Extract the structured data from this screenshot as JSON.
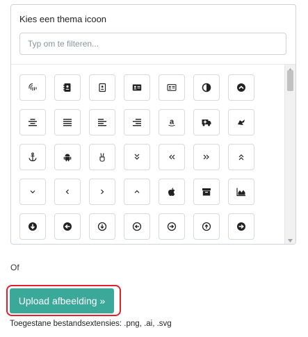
{
  "picker": {
    "title": "Kies een thema icoon",
    "filter_placeholder": "Typ om te filteren...",
    "filter_value": ""
  },
  "icons": [
    {
      "name": "fingerprint-icon",
      "glyph": "§"
    },
    {
      "name": "address-book-icon",
      "glyph": ""
    },
    {
      "name": "address-book-outline-icon",
      "glyph": ""
    },
    {
      "name": "address-card-icon",
      "glyph": ""
    },
    {
      "name": "address-card-outline-icon",
      "glyph": ""
    },
    {
      "name": "adjust-icon",
      "glyph": ""
    },
    {
      "name": "chevron-circle-up-icon",
      "glyph": ""
    },
    {
      "name": "align-center-icon",
      "glyph": ""
    },
    {
      "name": "align-justify-icon",
      "glyph": ""
    },
    {
      "name": "align-left-icon",
      "glyph": ""
    },
    {
      "name": "align-right-icon",
      "glyph": ""
    },
    {
      "name": "amazon-icon",
      "glyph": "a"
    },
    {
      "name": "ambulance-icon",
      "glyph": ""
    },
    {
      "name": "sign-language-icon",
      "glyph": ""
    },
    {
      "name": "anchor-icon",
      "glyph": "⚓"
    },
    {
      "name": "android-icon",
      "glyph": ""
    },
    {
      "name": "peace-hand-icon",
      "glyph": "✌"
    },
    {
      "name": "angle-double-down-icon",
      "glyph": "»"
    },
    {
      "name": "angle-double-left-icon",
      "glyph": "«"
    },
    {
      "name": "angle-double-right-icon",
      "glyph": "»"
    },
    {
      "name": "angle-double-up-icon",
      "glyph": "«"
    },
    {
      "name": "angle-down-icon",
      "glyph": ""
    },
    {
      "name": "angle-left-icon",
      "glyph": ""
    },
    {
      "name": "angle-right-icon",
      "glyph": ""
    },
    {
      "name": "angle-up-icon",
      "glyph": ""
    },
    {
      "name": "apple-icon",
      "glyph": ""
    },
    {
      "name": "archive-icon",
      "glyph": ""
    },
    {
      "name": "area-chart-icon",
      "glyph": ""
    },
    {
      "name": "arrow-circle-down-icon",
      "glyph": ""
    },
    {
      "name": "arrow-circle-left-icon",
      "glyph": ""
    },
    {
      "name": "arrow-circle-o-down-icon",
      "glyph": ""
    },
    {
      "name": "arrow-circle-o-left-icon",
      "glyph": ""
    },
    {
      "name": "arrow-circle-o-right-icon",
      "glyph": ""
    },
    {
      "name": "arrow-circle-o-up-icon",
      "glyph": ""
    },
    {
      "name": "arrow-circle-right-icon",
      "glyph": ""
    }
  ],
  "or_label": "Of",
  "upload": {
    "button_label": "Upload afbeelding »",
    "allowed_extensions": "Toegestane bestandsextensies: .png, .ai, .svg"
  },
  "colors": {
    "upload_button": "#3aa999",
    "highlight_outline": "#e0202a"
  }
}
